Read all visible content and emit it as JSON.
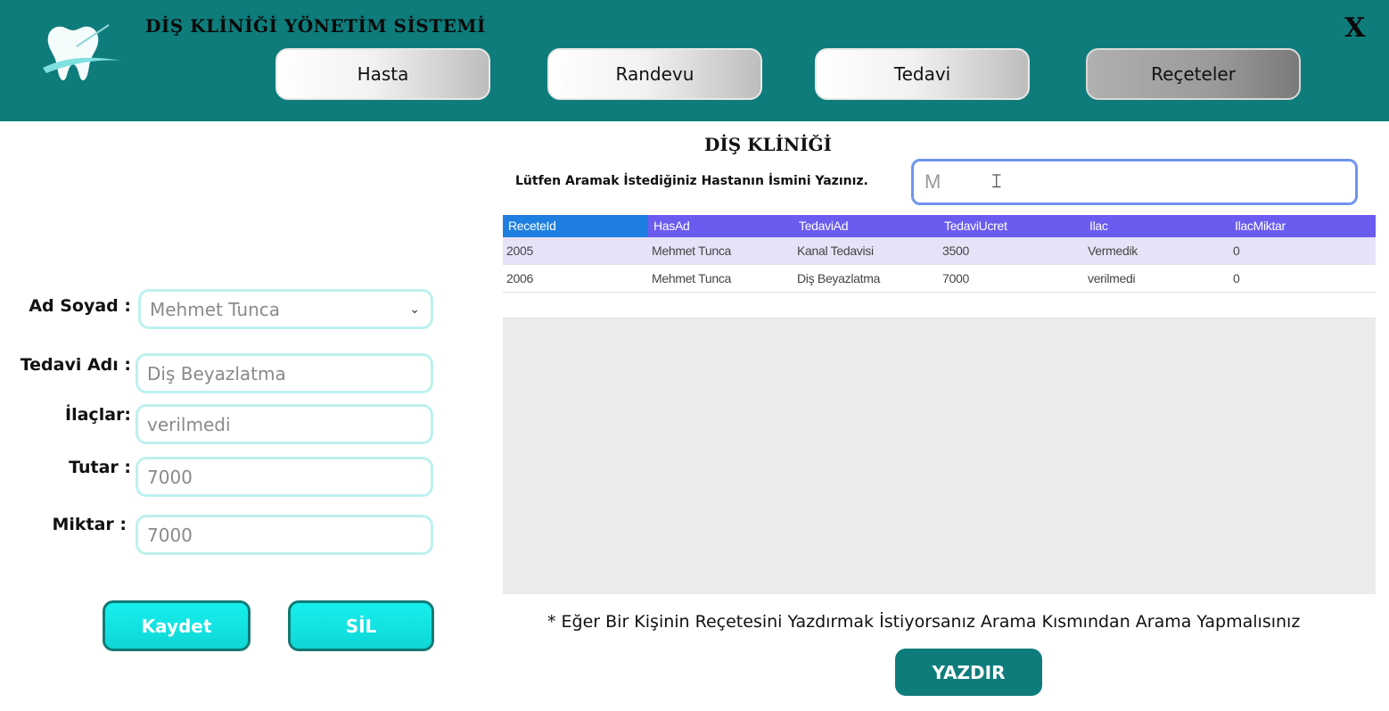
{
  "app": {
    "title": "DİŞ KLİNİĞİ YÖNETİM SİSTEMİ",
    "close_label": "X"
  },
  "nav": {
    "tabs": [
      {
        "label": "Hasta"
      },
      {
        "label": "Randevu"
      },
      {
        "label": "Tedavi"
      },
      {
        "label": "Reçeteler"
      }
    ],
    "active": "Reçeteler"
  },
  "search": {
    "clinic_title": "DİŞ KLİNİĞİ",
    "label": "Lütfen Aramak İstediğiniz Hastanın İsmini Yazınız.",
    "value": "M"
  },
  "table": {
    "columns": [
      "ReceteId",
      "HasAd",
      "TedaviAd",
      "TedaviUcret",
      "Ilac",
      "IlacMiktar"
    ],
    "rows": [
      [
        "2005",
        "Mehmet Tunca",
        "Kanal Tedavisi",
        "3500",
        "Vermedik",
        "0"
      ],
      [
        "2006",
        "Mehmet Tunca",
        "Diş Beyazlatma",
        "7000",
        "verilmedi",
        "0"
      ]
    ]
  },
  "form": {
    "name_label": "Ad Soyad :",
    "name_value": "Mehmet Tunca",
    "treatment_label": "Tedavi Adı :",
    "treatment_value": "Diş Beyazlatma",
    "drugs_label": "İlaçlar:",
    "drugs_value": "verilmedi",
    "amount_label": "Tutar :",
    "amount_value": "7000",
    "quantity_label": "Miktar :",
    "quantity_value": "7000"
  },
  "actions": {
    "save_label": "Kaydet",
    "delete_label": "SİL",
    "print_label": "YAZDIR"
  },
  "note": "* Eğer Bir Kişinin Reçetesini Yazdırmak İstiyorsanız Arama Kısmından Arama Yapmalısınız",
  "colors": {
    "header": "#0e7c7b",
    "grid_header": "#6b5cf0",
    "selected_header": "#1f7fe0",
    "field_border": "#bdf1ef",
    "button": "#16f0ee"
  }
}
